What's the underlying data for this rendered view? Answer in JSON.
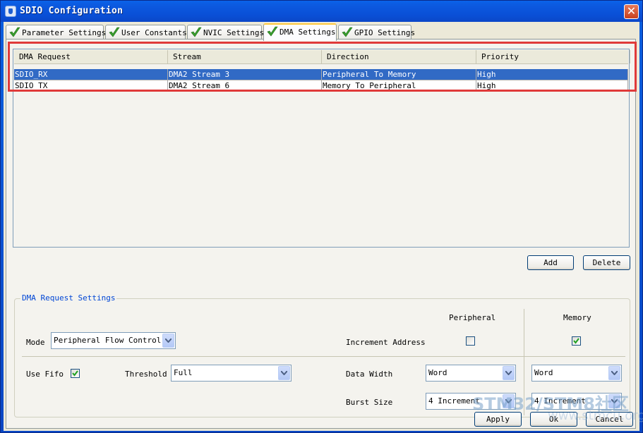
{
  "window": {
    "title": "SDIO Configuration"
  },
  "tabs": [
    {
      "label": "Parameter Settings"
    },
    {
      "label": "User Constants"
    },
    {
      "label": "NVIC Settings"
    },
    {
      "label": "DMA Settings"
    },
    {
      "label": "GPIO Settings"
    }
  ],
  "active_tab": "DMA Settings",
  "dma_table": {
    "columns": [
      "DMA Request",
      "Stream",
      "Direction",
      "Priority"
    ],
    "rows": [
      {
        "request": "SDIO_RX",
        "stream": "DMA2 Stream 3",
        "direction": "Peripheral To Memory",
        "priority": "High"
      },
      {
        "request": "SDIO_TX",
        "stream": "DMA2 Stream 6",
        "direction": "Memory To Peripheral",
        "priority": "High"
      }
    ]
  },
  "buttons": {
    "add": "Add",
    "delete": "Delete",
    "apply": "Apply",
    "ok": "Ok",
    "cancel": "Cancel"
  },
  "request_settings": {
    "title": "DMA Request Settings",
    "peripheral_header": "Peripheral",
    "memory_header": "Memory",
    "mode_label": "Mode",
    "mode_value": "Peripheral Flow Control",
    "increment_address_label": "Increment Address",
    "increment_peripheral_checked": false,
    "increment_memory_checked": true,
    "use_fifo_label": "Use Fifo",
    "use_fifo_checked": true,
    "threshold_label": "Threshold",
    "threshold_value": "Full",
    "data_width_label": "Data Width",
    "data_width_peripheral": "Word",
    "data_width_memory": "Word",
    "burst_size_label": "Burst Size",
    "burst_size_peripheral": "4 Increment",
    "burst_size_memory": "4 Increment"
  },
  "watermark": {
    "line1": "STM32/STM8社区",
    "line2": "www.stmcu.org"
  },
  "colors": {
    "selection": "#316ac5",
    "highlight_box": "#e03a3a",
    "group_title": "#0046d5"
  }
}
